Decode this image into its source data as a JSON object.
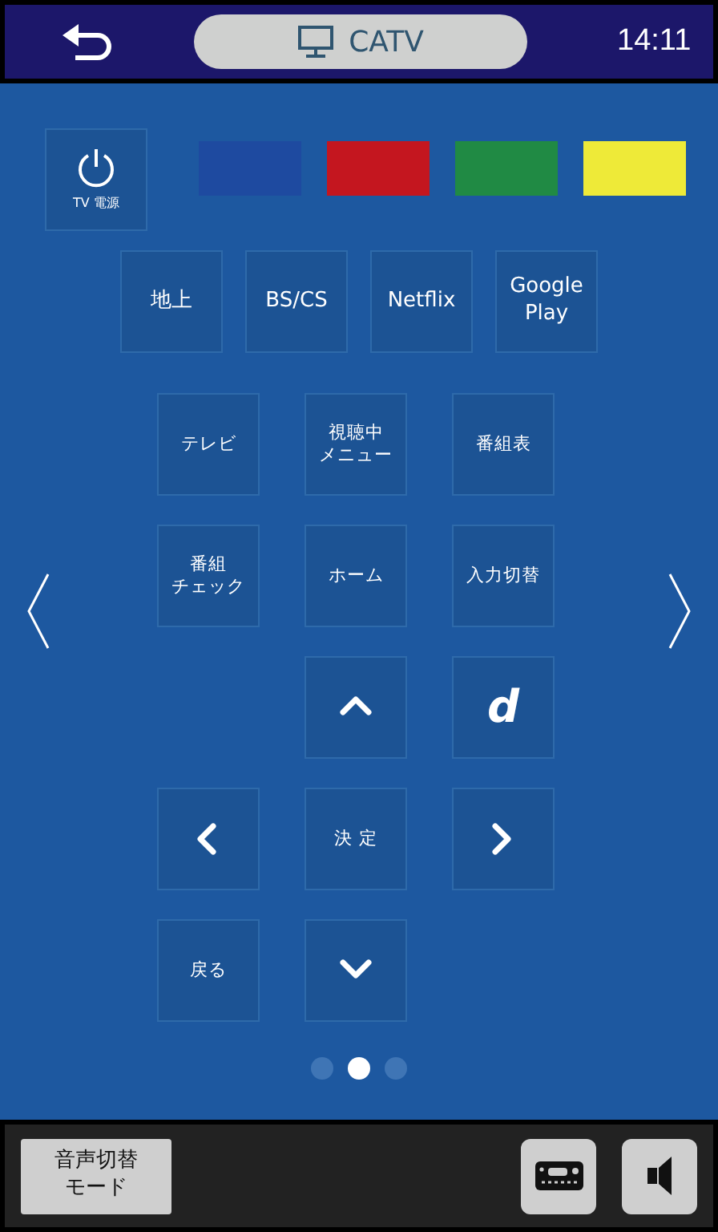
{
  "header": {
    "title": "CATV",
    "time": "14:11"
  },
  "power_button": {
    "label": "TV 電源"
  },
  "color_buttons": [
    {
      "color": "#1e4aa0"
    },
    {
      "color": "#c4161f"
    },
    {
      "color": "#208a44"
    },
    {
      "color": "#eeea38"
    }
  ],
  "source_buttons": [
    {
      "label": "地上"
    },
    {
      "label": "BS/CS"
    },
    {
      "label": "Netflix"
    },
    {
      "label": "Google\nPlay"
    }
  ],
  "pad_rows": [
    [
      {
        "kind": "text",
        "label": "テレビ"
      },
      {
        "kind": "text",
        "lines": [
          "視聴中",
          "メニュー"
        ]
      },
      {
        "kind": "text",
        "label": "番組表"
      }
    ],
    [
      {
        "kind": "text",
        "lines": [
          "番組",
          "チェック"
        ]
      },
      {
        "kind": "text",
        "label": "ホーム"
      },
      {
        "kind": "text",
        "label": "入力切替"
      }
    ],
    [
      {
        "kind": "gap"
      },
      {
        "kind": "up"
      },
      {
        "kind": "logo",
        "label": "d"
      }
    ],
    [
      {
        "kind": "left"
      },
      {
        "kind": "text",
        "label": "決 定"
      },
      {
        "kind": "right"
      }
    ],
    [
      {
        "kind": "text",
        "label": "戻る"
      },
      {
        "kind": "down"
      },
      {
        "kind": "gap"
      }
    ]
  ],
  "page_dots": [
    {
      "selected": false
    },
    {
      "selected": true
    },
    {
      "selected": false
    }
  ],
  "bottom_bar": {
    "mode_button": [
      "音声切替",
      "モード"
    ]
  }
}
